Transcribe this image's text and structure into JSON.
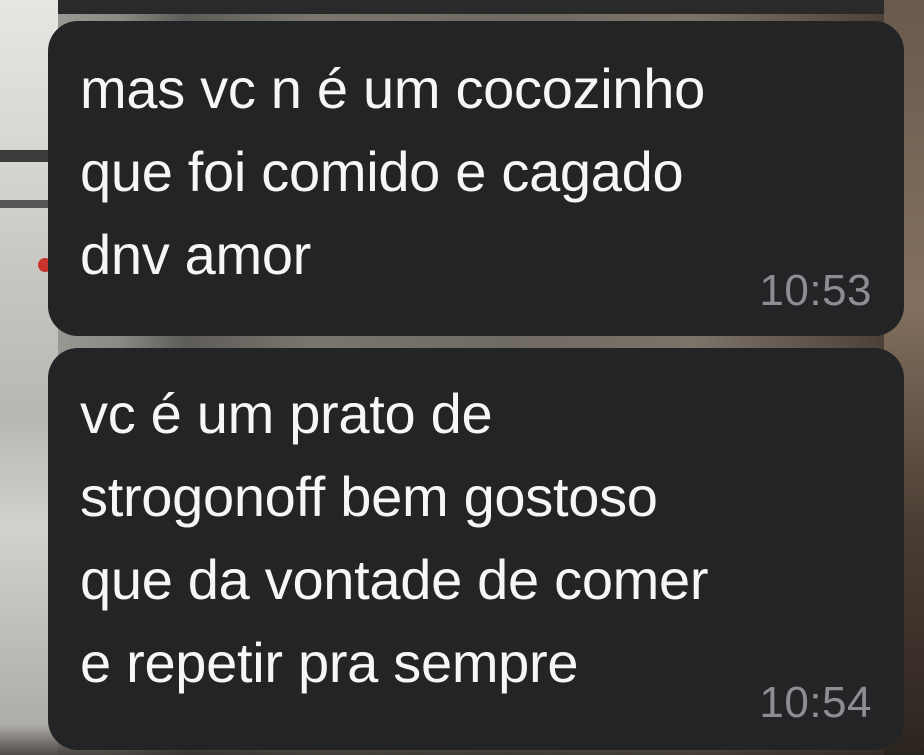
{
  "messages": [
    {
      "text": "mas vc n é um cocozinho\nque foi comido e cagado\ndnv amor",
      "time": "10:53"
    },
    {
      "text": "vc é um prato de\nstrogonoff bem gostoso\nque da vontade de comer\ne repetir pra sempre",
      "time": "10:54"
    }
  ],
  "colors": {
    "bubble": "#232426",
    "text": "#f6f6f6",
    "timestamp": "#8d8e92"
  }
}
